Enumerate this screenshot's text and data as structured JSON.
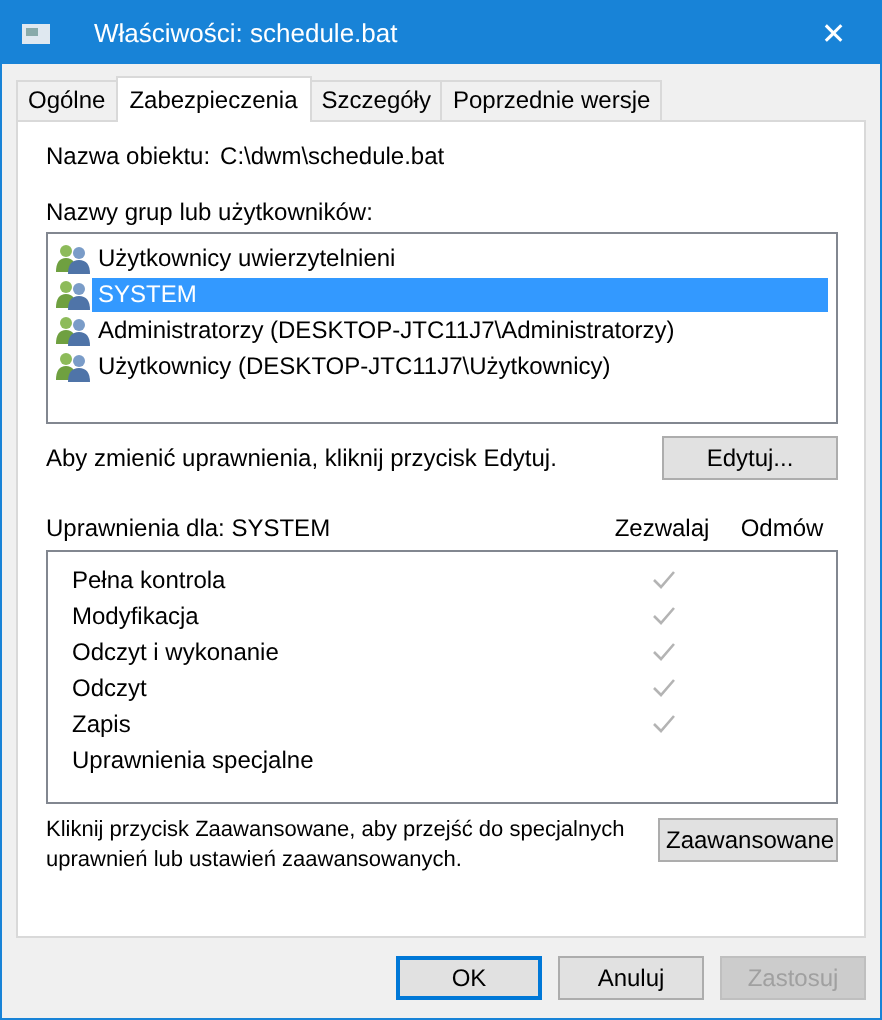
{
  "window": {
    "title": "Właściwości: schedule.bat",
    "close": "✕"
  },
  "tabs": [
    {
      "label": "Ogólne",
      "selected": false
    },
    {
      "label": "Zabezpieczenia",
      "selected": true
    },
    {
      "label": "Szczegóły",
      "selected": false
    },
    {
      "label": "Poprzednie wersje",
      "selected": false
    }
  ],
  "object_name": {
    "label": "Nazwa obiektu:",
    "value": "C:\\dwm\\schedule.bat"
  },
  "groups": {
    "label": "Nazwy grup lub użytkowników:",
    "items": [
      {
        "name": "Użytkownicy uwierzytelnieni",
        "selected": false
      },
      {
        "name": "SYSTEM",
        "selected": true
      },
      {
        "name": "Administratorzy (DESKTOP-JTC11J7\\Administratorzy)",
        "selected": false
      },
      {
        "name": "Użytkownicy (DESKTOP-JTC11J7\\Użytkownicy)",
        "selected": false
      }
    ]
  },
  "edit_hint": "Aby zmienić uprawnienia, kliknij przycisk Edytuj.",
  "edit_button": "Edytuj...",
  "permissions": {
    "label": "Uprawnienia dla: SYSTEM",
    "allow_header": "Zezwalaj",
    "deny_header": "Odmów",
    "rows": [
      {
        "name": "Pełna kontrola",
        "allow": true,
        "deny": false
      },
      {
        "name": "Modyfikacja",
        "allow": true,
        "deny": false
      },
      {
        "name": "Odczyt i wykonanie",
        "allow": true,
        "deny": false
      },
      {
        "name": "Odczyt",
        "allow": true,
        "deny": false
      },
      {
        "name": "Zapis",
        "allow": true,
        "deny": false
      },
      {
        "name": "Uprawnienia specjalne",
        "allow": false,
        "deny": false
      }
    ]
  },
  "advanced_hint": "Kliknij przycisk Zaawansowane, aby przejść do specjalnych uprawnień lub ustawień zaawansowanych.",
  "advanced_button": "Zaawansowane",
  "buttons": [
    {
      "label": "OK",
      "default": true,
      "disabled": false
    },
    {
      "label": "Anuluj",
      "default": false,
      "disabled": false
    },
    {
      "label": "Zastosuj",
      "default": false,
      "disabled": true
    }
  ]
}
